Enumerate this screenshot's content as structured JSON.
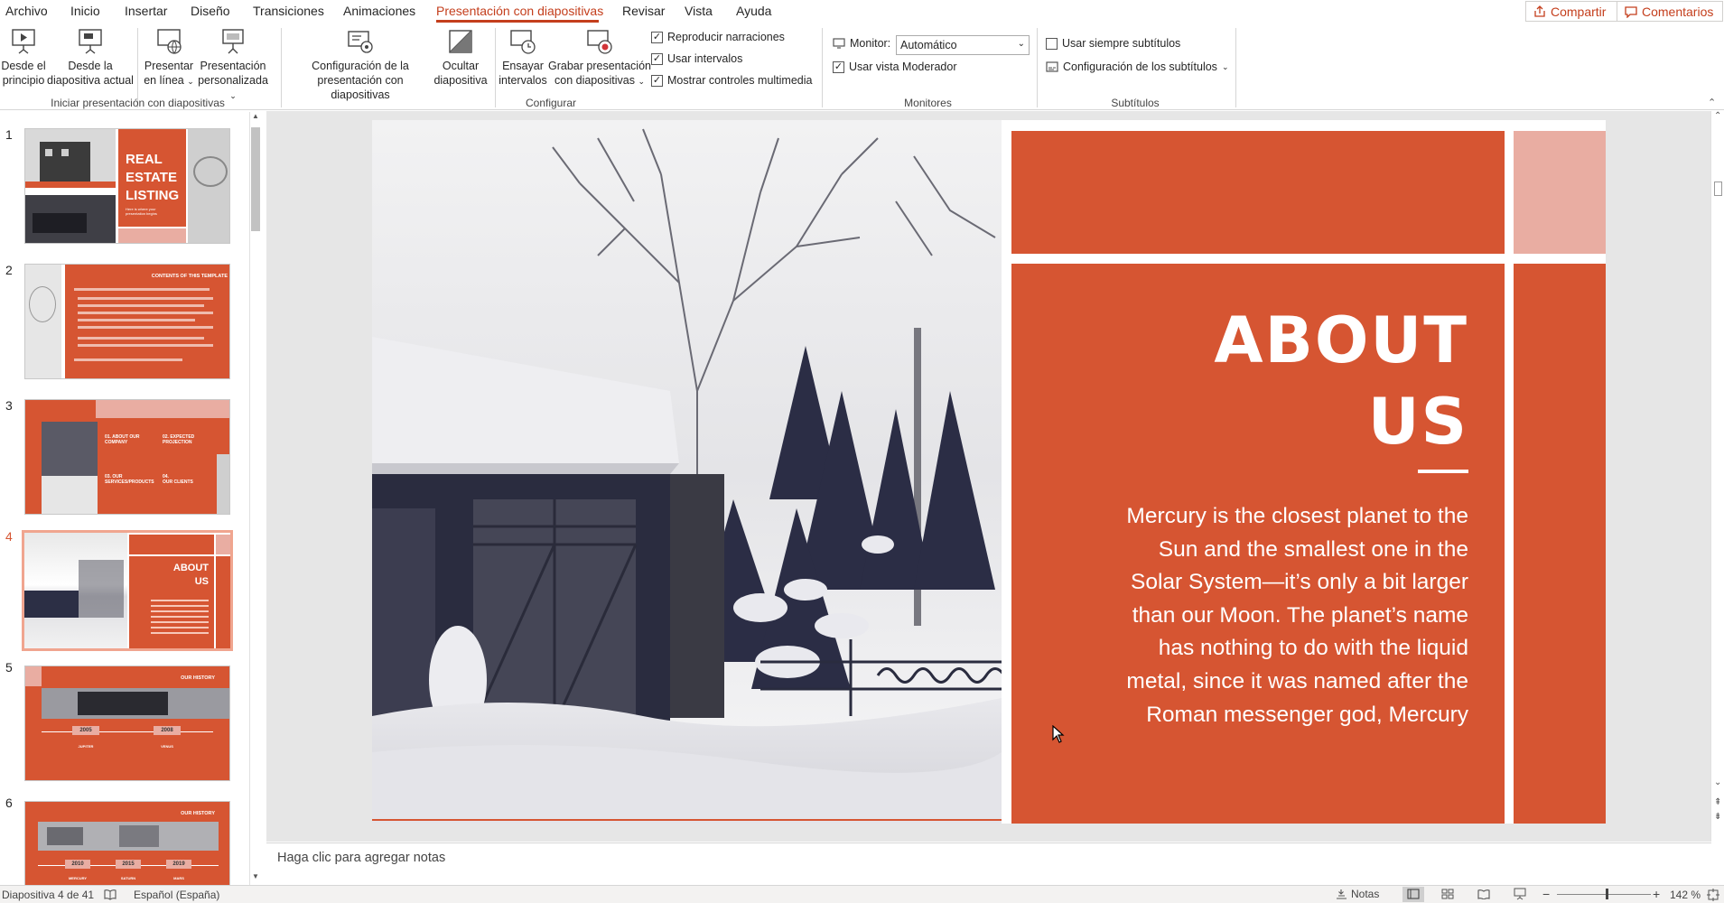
{
  "menu": {
    "items": [
      "Archivo",
      "Inicio",
      "Insertar",
      "Diseño",
      "Transiciones",
      "Animaciones",
      "Presentación con diapositivas",
      "Revisar",
      "Vista",
      "Ayuda"
    ],
    "active": "Presentación con diapositivas",
    "share_label": "Compartir",
    "comments_label": "Comentarios"
  },
  "ribbon": {
    "start_group": {
      "label": "Iniciar presentación con diapositivas",
      "from_start": [
        "Desde el",
        "principio"
      ],
      "from_current": [
        "Desde la",
        "diapositiva actual"
      ],
      "present_online": [
        "Presentar",
        "en línea"
      ],
      "custom_show": [
        "Presentación",
        "personalizada"
      ]
    },
    "setup_group": {
      "label": "Configurar",
      "setup_show": [
        "Configuración de la",
        "presentación con diapositivas"
      ],
      "hide_slide": [
        "Ocultar",
        "diapositiva"
      ],
      "rehearse": [
        "Ensayar",
        "intervalos"
      ],
      "record": [
        "Grabar presentación",
        "con diapositivas"
      ],
      "play_narrations": "Reproducir narraciones",
      "use_timings": "Usar intervalos",
      "show_media_controls": "Mostrar controles multimedia"
    },
    "monitors_group": {
      "label": "Monitores",
      "monitor_label": "Monitor:",
      "monitor_value": "Automático",
      "presenter_view": "Usar vista Moderador"
    },
    "subtitles_group": {
      "label": "Subtítulos",
      "always_subtitles": "Usar siempre subtítulos",
      "subtitle_settings": "Configuración de los subtítulos"
    }
  },
  "thumbnails": {
    "numbers": [
      "1",
      "2",
      "3",
      "4",
      "5",
      "6"
    ],
    "selected": 4,
    "t1": {
      "title": [
        "REAL",
        "ESTATE",
        "LISTING"
      ],
      "sub": [
        "Here is where your",
        "presentation begins"
      ]
    },
    "t2": {
      "title": "CONTENTS OF THIS TEMPLATE"
    },
    "t3": {
      "items": [
        [
          "01. ABOUT OUR",
          "COMPANY"
        ],
        [
          "02. EXPECTED",
          "PROJECTION"
        ],
        [
          "03. OUR",
          "SERVICES/PRODUCTS"
        ],
        [
          "04.",
          "OUR CLIENTS"
        ]
      ]
    },
    "t4": {
      "title": [
        "ABOUT",
        "US"
      ]
    },
    "t5": {
      "title": "OUR HISTORY",
      "years": [
        "2005",
        "2008"
      ],
      "labels": [
        "JUPITER",
        "VENUS"
      ]
    },
    "t6": {
      "title": "OUR HISTORY",
      "years": [
        "2010",
        "2015",
        "2019"
      ],
      "labels": [
        "MERCURY",
        "SATURN",
        "MARS"
      ]
    }
  },
  "slide": {
    "title_line1": "ABOUT",
    "title_line2": "US",
    "body": [
      "Mercury is the closest planet to the",
      "Sun and the smallest one in the",
      "Solar System—it’s only a bit larger",
      "than our Moon. The planet’s name",
      "has nothing to do with the liquid",
      "metal, since it was named after the",
      "Roman messenger god, Mercury"
    ]
  },
  "notes": {
    "placeholder": "Haga clic para agregar notas"
  },
  "status": {
    "slide_info": "Diapositiva 4 de 41",
    "language": "Español (España)",
    "notes_label": "Notas",
    "zoom": "142 %"
  },
  "colors": {
    "accent": "#d65532",
    "pink": "#e9ada2",
    "menu_active": "#c43e1c"
  }
}
